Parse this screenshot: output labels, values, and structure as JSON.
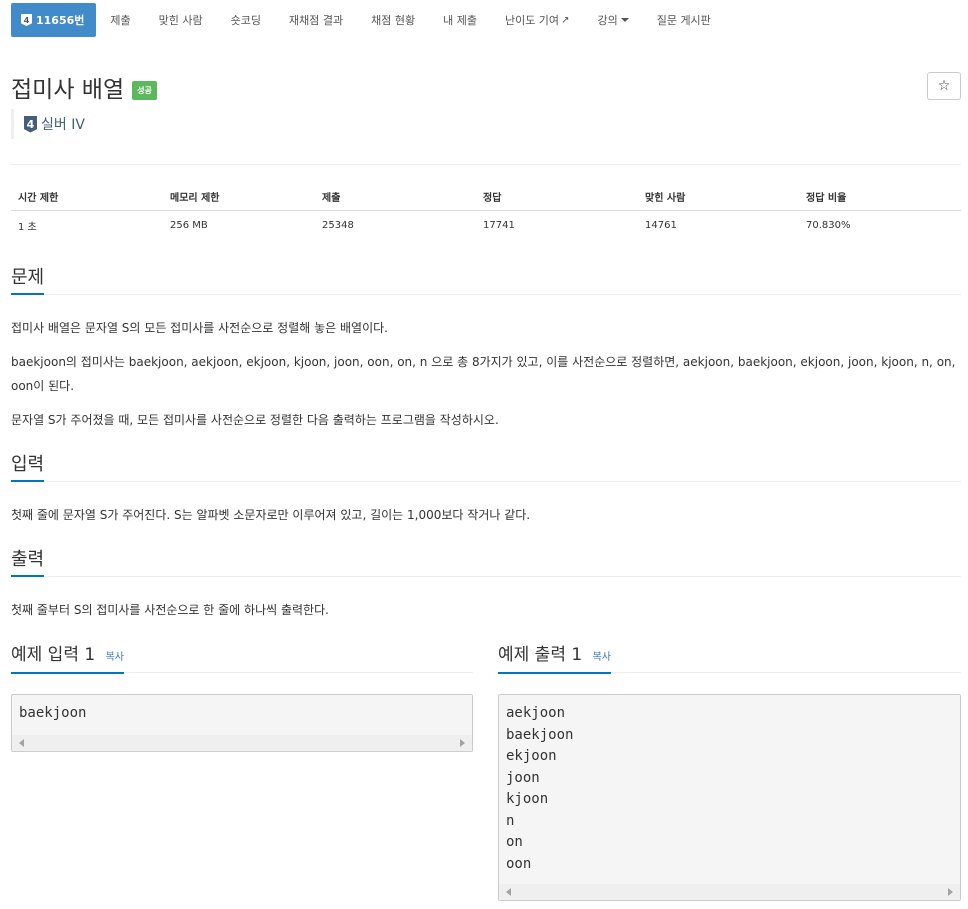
{
  "nav": {
    "tabs": [
      {
        "label": "11656번",
        "badge": "4",
        "active": true
      },
      {
        "label": "제출"
      },
      {
        "label": "맞힌 사람"
      },
      {
        "label": "숏코딩"
      },
      {
        "label": "재채점 결과"
      },
      {
        "label": "채점 현황"
      },
      {
        "label": "내 제출"
      },
      {
        "label": "난이도 기여",
        "icon": "external-link-icon"
      },
      {
        "label": "강의",
        "icon": "caret-down-icon"
      },
      {
        "label": "질문 게시판"
      }
    ]
  },
  "problem": {
    "title": "접미사 배열",
    "result_badge": "성공",
    "tier_number": "4",
    "tier_label": "실버 IV",
    "star_icon": "☆"
  },
  "info_table": {
    "headers": [
      "시간 제한",
      "메모리 제한",
      "제출",
      "정답",
      "맞힌 사람",
      "정답 비율"
    ],
    "values": [
      "1 초",
      "256 MB",
      "25348",
      "17741",
      "14761",
      "70.830%"
    ]
  },
  "sections": {
    "description": {
      "heading": "문제",
      "paragraphs": [
        "접미사 배열은 문자열 S의 모든 접미사를 사전순으로 정렬해 놓은 배열이다.",
        "baekjoon의 접미사는 baekjoon, aekjoon, ekjoon, kjoon, joon, oon, on, n 으로 총 8가지가 있고, 이를 사전순으로 정렬하면, aekjoon, baekjoon, ekjoon, joon, kjoon, n, on, oon이 된다.",
        "문자열 S가 주어졌을 때, 모든 접미사를 사전순으로 정렬한 다음 출력하는 프로그램을 작성하시오."
      ]
    },
    "input": {
      "heading": "입력",
      "text": "첫째 줄에 문자열 S가 주어진다. S는 알파벳 소문자로만 이루어져 있고, 길이는 1,000보다 작거나 같다."
    },
    "output": {
      "heading": "출력",
      "text": "첫째 줄부터 S의 접미사를 사전순으로 한 줄에 하나씩 출력한다."
    }
  },
  "samples": {
    "input_heading": "예제 입력 1",
    "output_heading": "예제 출력 1",
    "copy_label": "복사",
    "input": "baekjoon",
    "output": "aekjoon\nbaekjoon\nekjoon\njoon\nkjoon\nn\non\noon"
  },
  "colors": {
    "active_tab": "#428bca",
    "success_badge": "#5cb85c",
    "section_underline": "#0076c0",
    "tier": "#435f7a"
  }
}
